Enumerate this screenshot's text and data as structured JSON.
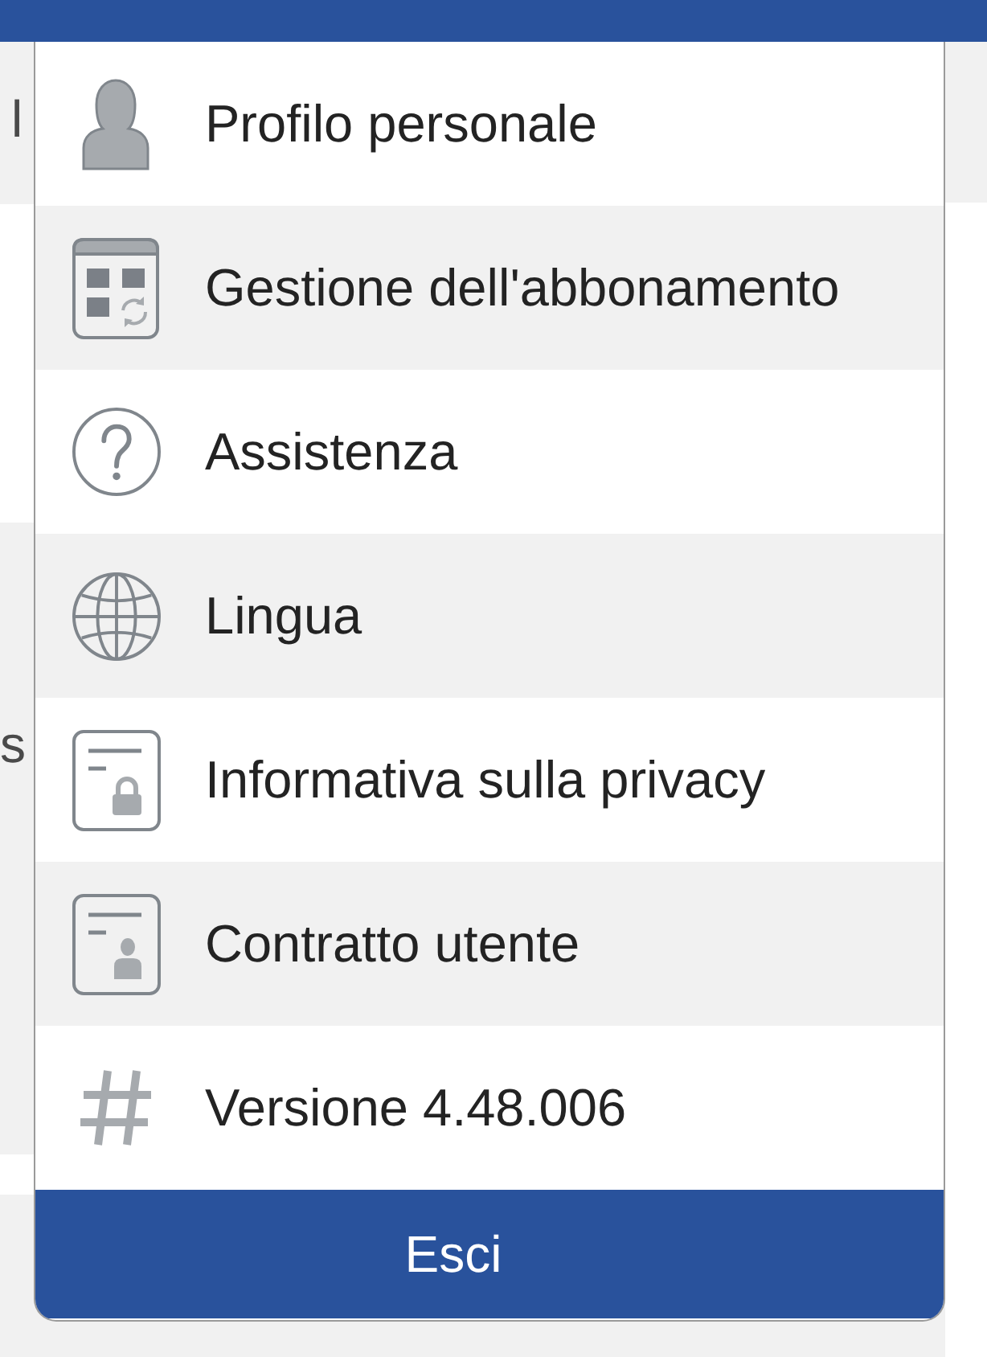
{
  "background": {
    "texts": [
      "l",
      "s"
    ]
  },
  "menu": {
    "items": [
      "Profilo personale",
      "Gestione dell'abbonamento",
      "Assistenza",
      "Lingua",
      "Informativa sulla privacy",
      "Contratto utente"
    ],
    "version": "Versione 4.48.006",
    "logout_button": "Esci"
  }
}
